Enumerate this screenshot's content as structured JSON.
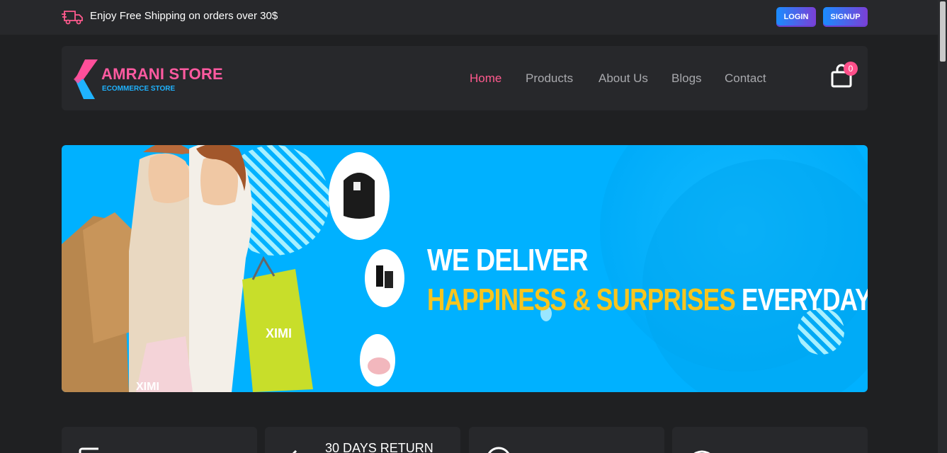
{
  "topbar": {
    "shipping_text": "Enjoy Free Shipping on orders over 30$",
    "login_label": "LOGIN",
    "signup_label": "SIGNUP"
  },
  "brand": {
    "name": "AMRANI STORE",
    "tagline": "ECOMMERCE STORE"
  },
  "nav": {
    "items": [
      {
        "label": "Home",
        "active": true
      },
      {
        "label": "Products",
        "active": false
      },
      {
        "label": "About Us",
        "active": false
      },
      {
        "label": "Blogs",
        "active": false
      },
      {
        "label": "Contact",
        "active": false
      }
    ]
  },
  "cart": {
    "count": "0",
    "icon": "shopping-bag-icon"
  },
  "banner": {
    "line1": "WE DELIVER",
    "line2_highlight": "HAPPINESS & SURPRISES",
    "line2_rest": "EVERYDAY",
    "logo_text": "XIMI"
  },
  "features": [
    {
      "title": ""
    },
    {
      "title": "30 DAYS RETURN"
    },
    {
      "title": ""
    },
    {
      "title": ""
    }
  ],
  "colors": {
    "accent_pink": "#ff5a8e",
    "banner_blue": "#00b1ff",
    "highlight_yellow": "#f7c51e",
    "background": "#1f2022",
    "surface": "#27282b"
  }
}
